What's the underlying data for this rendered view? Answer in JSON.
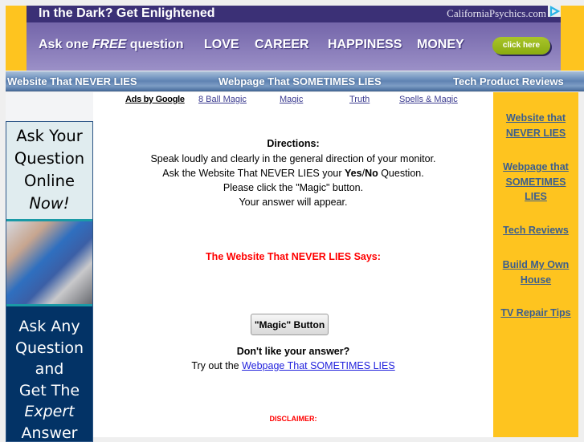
{
  "banner": {
    "headline": "In the Dark? Get Enlightened",
    "brand": "CaliforniaPsychics.com",
    "ask_prefix": "Ask one ",
    "ask_free": "FREE",
    "ask_suffix": " question",
    "topics": [
      "LOVE",
      "CAREER",
      "HAPPINESS",
      "MONEY"
    ],
    "cta": "click here",
    "adchoices_icon": "adchoices-triangle-icon"
  },
  "nav": {
    "items": [
      {
        "label": "Website That NEVER LIES"
      },
      {
        "label": "Webpage That SOMETIMES LIES"
      },
      {
        "label": "Tech Product Reviews"
      }
    ]
  },
  "ads_row": {
    "label": "Ads by Google",
    "links": [
      "8 Ball Magic",
      "Magic",
      "Truth",
      "Spells & Magic"
    ]
  },
  "left_ad": {
    "top_lines": [
      "Ask Your",
      "Question",
      "Online"
    ],
    "top_emph": "Now!",
    "bottom_lines": [
      "Ask Any",
      "Question",
      "and",
      "Get The"
    ],
    "bottom_emph": "Expert",
    "bottom_last": "Answer"
  },
  "main": {
    "directions_title": "Directions:",
    "line1": "Speak loudly and clearly in the general direction of your monitor.",
    "line2_prefix": "Ask the Website That NEVER LIES your ",
    "line2_yes": "Yes",
    "line2_slash": "/",
    "line2_no": "No",
    "line2_suffix": " Question.",
    "line3": "Please click the \"Magic\" button.",
    "line4": "Your answer will appear.",
    "says": "The Website That NEVER LIES Says:",
    "magic_button": "\"Magic\" Button",
    "dislike": "Don't like your answer?",
    "tryout_prefix": "Try out the ",
    "tryout_link": "Webpage That SOMETIMES LIES",
    "disclaimer": "DISCLAIMER:"
  },
  "sidebar": {
    "links": [
      {
        "lines": [
          "Website that",
          "NEVER LIES"
        ]
      },
      {
        "lines": [
          "Webpage that",
          "SOMETIMES",
          "LIES"
        ]
      },
      {
        "lines": [
          "Tech Reviews"
        ]
      },
      {
        "lines": [
          "Build My Own",
          "House"
        ]
      },
      {
        "lines": [
          "TV Repair Tips"
        ]
      }
    ]
  },
  "colors": {
    "banner_yellow": "#fec41f",
    "banner_purple_dark": "#3b3076",
    "cta_green": "#9bbb1c",
    "nav_blue": "#5f83b3",
    "says_red": "#ff0000",
    "link_blue": "#2222dd",
    "sidebar_link": "#3b5e8e",
    "left_ad_navy": "#033366"
  }
}
